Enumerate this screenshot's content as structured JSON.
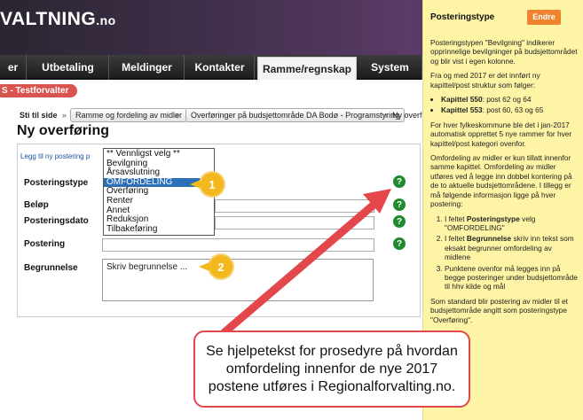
{
  "header": {
    "logo_main": "VALTNING",
    "logo_tld": ".no"
  },
  "nav": {
    "tabs": [
      {
        "label": "er"
      },
      {
        "label": "Utbetaling"
      },
      {
        "label": "Meldinger"
      },
      {
        "label": "Kontakter"
      },
      {
        "label": "Ramme/regnskap",
        "active": true
      },
      {
        "label": "System"
      }
    ]
  },
  "user_badge": "S - Testforvalter",
  "breadcrumb": {
    "label": "Sti til side",
    "items": [
      "Ramme og fordeling av midler",
      "Overføringer på budsjettområde DA Bodø - Programstyring",
      "Ny overf"
    ]
  },
  "page_title": "Ny overføring",
  "form": {
    "tab_link": "Legg til ny postering p",
    "labels": {
      "posteringstype": "Posteringstype",
      "belop": "Beløp",
      "posteringsdato": "Posteringsdato",
      "postering": "Postering",
      "begrunnelse": "Begrunnelse"
    },
    "dropdown_options": [
      "** Vennligst velg **",
      "Bevilgning",
      "Årsavslutning",
      "OMFORDELING",
      "Overføring",
      "Renter",
      "Annet",
      "Reduksjon",
      "Tilbakeføring"
    ],
    "dropdown_selected": "OMFORDELING",
    "begrunnelse_value": "Skriv begrunnelse ...",
    "help_glyph": "?"
  },
  "markers": {
    "one": "1",
    "two": "2"
  },
  "sidebar": {
    "title": "Posteringstype",
    "edit_label": "Endre",
    "p1": "Posteringstypen \"Bevilgning\" indikerer opprinnelige bevilgninger på budsjettområdet og blir vist i egen kolonne.",
    "p2": "Fra og med 2017 er det innført ny kapittel/post struktur som følger:",
    "k1_name": "Kapittel 550",
    "k1_rest": ": post 62 og 64",
    "k2_name": "Kapittel 553",
    "k2_rest": ": post 60, 63 og 65",
    "p3": "For hver fylkeskommune ble det i jan-2017 automatisk opprettet 5 nye rammer for hver kapittel/post kategori ovenfor.",
    "p4": "Omfordeling av midler er kun tillatt innenfor samme kapittel. Omfordeling av midler utføres ved å legge inn dobbel kontering på de to aktuelle budsjettområdene. I tillegg er må følgende informasjon ligge på hver postering:",
    "s1_pre": "I feltet ",
    "s1_bold": "Posteringstype",
    "s1_post": " velg \"OMFORDELING\"",
    "s2_pre": "I feltet ",
    "s2_bold": "Begrunnelse",
    "s2_post": " skriv inn tekst som eksakt begrunner omfordeling av midlene",
    "s3": "Punktene ovenfor må legges inn på begge posteringer  under budsjettområde til hhv kilde og mål",
    "p5": "Som standard blir postering av midler til et budsjettområde angitt som posteringstype \"Overføring\"."
  },
  "callout": "Se hjelpetekst for prosedyre på hvordan omfordeling innenfor de nye 2017 postene utføres i Regionalforvalting.no."
}
